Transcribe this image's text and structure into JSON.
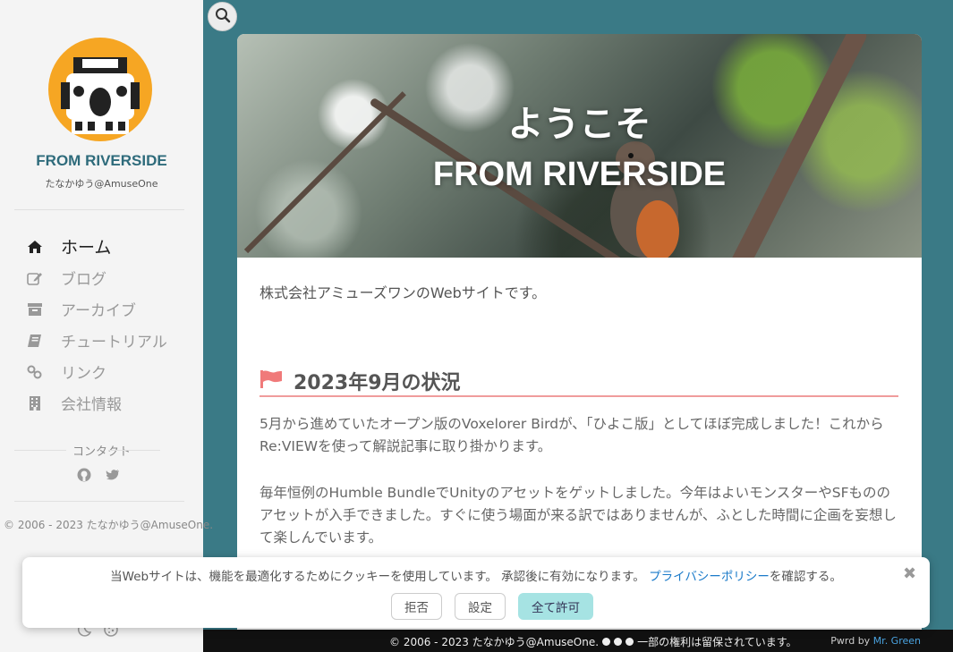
{
  "sidebar": {
    "site_name": "FROM RIVERSIDE",
    "author": "たなかゆう@AmuseOne",
    "nav": [
      {
        "label": "ホーム",
        "icon": "home-icon",
        "active": true
      },
      {
        "label": "ブログ",
        "icon": "edit-icon",
        "active": false
      },
      {
        "label": "アーカイブ",
        "icon": "archive-icon",
        "active": false
      },
      {
        "label": "チュートリアル",
        "icon": "book-icon",
        "active": false
      },
      {
        "label": "リンク",
        "icon": "link-icon",
        "active": false
      },
      {
        "label": "会社情報",
        "icon": "building-icon",
        "active": false
      }
    ],
    "contact_label": "コンタクト",
    "copyright": "© 2006 - 2023 たなかゆう@AmuseOne."
  },
  "hero": {
    "title": "ようこそ",
    "subtitle": "FROM RIVERSIDE"
  },
  "content": {
    "intro": "株式会社アミューズワンのWebサイトです。",
    "section_title": "2023年9月の状況",
    "para1": "5月から進めていたオープン版のVoxelorer Birdが、「ひよこ版」としてほぼ完成しました！これからRe:VIEWを使って解説記事に取り掛かります。",
    "para2": "毎年恒例のHumble BundleでUnityのアセットをゲットしました。今年はよいモンスターやSFもののアセットが入手できました。すぐに使う場面が来る訳ではありませんが、ふとした時間に企画を妄想して楽しんでいます。"
  },
  "cookie": {
    "message": "当Webサイトは、機能を最適化するためにクッキーを使用しています。 承認後に有効になります。",
    "policy_link": "プライバシーポリシー",
    "policy_suffix": "を確認する。",
    "reject": "拒否",
    "settings": "設定",
    "accept_all": "全て許可"
  },
  "footer": {
    "copyright": "© 2006 - 2023 たなかゆう@AmuseOne.",
    "rights": "一部の権利は留保されています。",
    "pwrd_prefix": "Pwrd by",
    "pwrd_link": "Mr. Green"
  },
  "colors": {
    "background": "#3a7a86",
    "accent": "#2e6b7b",
    "flag": "#f07a7a",
    "accept": "#a6e3e3"
  }
}
